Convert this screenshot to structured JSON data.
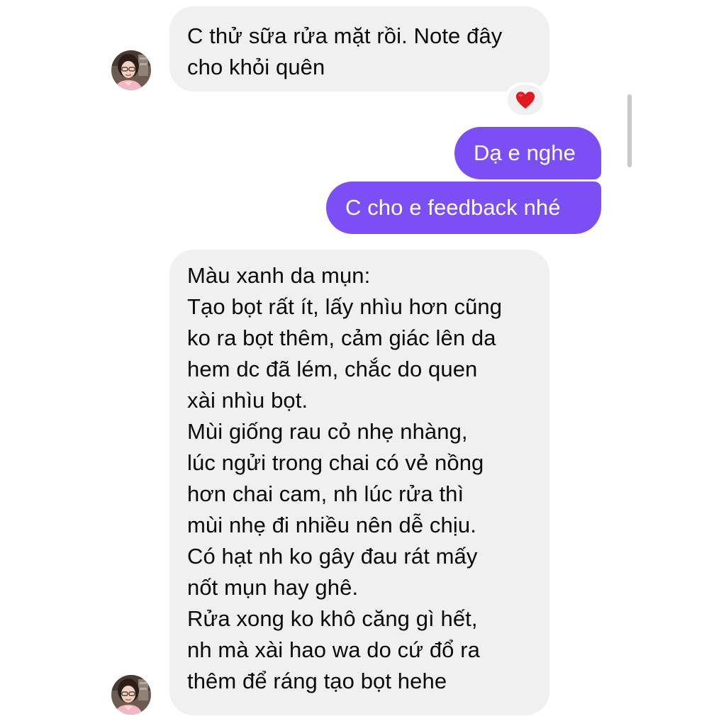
{
  "conversation": {
    "messages": [
      {
        "sender": "contact",
        "lines": [
          "C thử sữa rửa mặt rồi. Note đây",
          "cho khỏi quên"
        ],
        "reaction": "❤️"
      },
      {
        "sender": "me",
        "lines": [
          "Dạ e nghe"
        ]
      },
      {
        "sender": "me",
        "lines": [
          "C cho e feedback nhé"
        ]
      },
      {
        "sender": "contact",
        "lines": [
          "Màu xanh da mụn:",
          "Tạo bọt rất ít, lấy nhìu hơn cũng",
          "ko ra bọt thêm, cảm giác lên da",
          "hem dc đã lém, chắc do quen",
          "xài nhìu bọt.",
          "Mùi giống rau cỏ nhẹ nhàng,",
          "lúc ngửi trong chai có vẻ nồng",
          "hơn chai cam, nh lúc rửa thì",
          "mùi nhẹ đi nhiều nên dễ chịu.",
          "Có hạt nh ko gây đau rát mấy",
          "nốt mụn hay ghê.",
          "Rửa xong ko khô căng gì hết,",
          "nh mà xài hao wa do cứ đổ ra",
          "thêm để ráng tạo bọt hehe"
        ]
      }
    ]
  },
  "colors": {
    "incoming_bubble": "#f0f0f1",
    "outgoing_bubble": "#7b4ff5",
    "outgoing_text": "#ffffff",
    "incoming_text": "#0a0a0a",
    "scrollbar": "#c9c9cc"
  },
  "icons": {
    "reaction": "heart-icon",
    "avatar": "avatar"
  }
}
